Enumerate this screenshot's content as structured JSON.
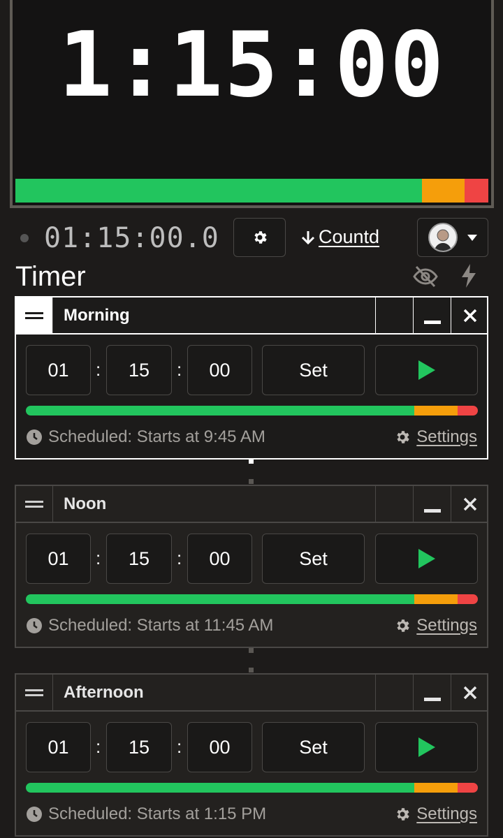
{
  "preview": {
    "clock": "1:15:00",
    "progress": {
      "green": 0.86,
      "orange": 0.09,
      "red": 0.05
    }
  },
  "controls": {
    "readout": "01:15:00.0",
    "mode_label": "Countd"
  },
  "heading": "Timer",
  "colors": {
    "green": "#22c55e",
    "orange": "#f59e0b",
    "red": "#ef4444",
    "background": "#1d1b1a"
  },
  "timers": [
    {
      "title": "Morning",
      "hours": "01",
      "minutes": "15",
      "seconds": "00",
      "set_label": "Set",
      "schedule": "Scheduled: Starts at 9:45 AM",
      "settings_label": "Settings"
    },
    {
      "title": "Noon",
      "hours": "01",
      "minutes": "15",
      "seconds": "00",
      "set_label": "Set",
      "schedule": "Scheduled: Starts at 11:45 AM",
      "settings_label": "Settings"
    },
    {
      "title": "Afternoon",
      "hours": "01",
      "minutes": "15",
      "seconds": "00",
      "set_label": "Set",
      "schedule": "Scheduled: Starts at 1:15 PM",
      "settings_label": "Settings"
    }
  ],
  "icons": [
    "drag-handle-icon",
    "minimize-icon",
    "close-icon",
    "play-icon",
    "clock-icon",
    "gear-icon",
    "arrow-down-icon",
    "chevron-down-icon",
    "eye-off-icon",
    "bolt-icon"
  ]
}
